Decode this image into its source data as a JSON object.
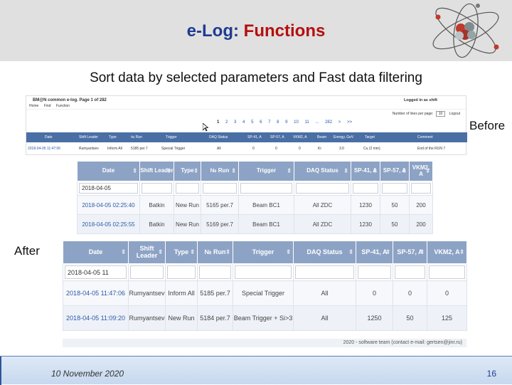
{
  "slide": {
    "title_part1": "e-Log",
    "title_colon": ":",
    "title_part2": " Functions",
    "subtitle": "Sort data by selected parameters and Fast data filtering",
    "label_before": "Before",
    "label_after": "After",
    "date": "10 November 2020",
    "page_number": "16",
    "colors": {
      "title_blue": "#1f3b8f",
      "title_red": "#b50f0f",
      "header_bg": "#e0e0e0",
      "table_header": "#8da3c5"
    }
  },
  "before": {
    "brand": "BM@N common e-log. Page 1 of 282",
    "logged": "Logged in as shift",
    "nav": [
      "Home",
      "Find",
      "Function"
    ],
    "pager": [
      "1",
      "2",
      "3",
      "4",
      "5",
      "6",
      "7",
      "8",
      "9",
      "10",
      "11",
      "...",
      "282",
      ">",
      ">>"
    ],
    "per_page_label": "Number of lines per page:",
    "per_page_value": "10",
    "logout": "Logout",
    "columns": [
      "Date",
      "Shift Leader",
      "Type",
      "№ Run",
      "Trigger",
      "DAQ Status",
      "SP-41, A",
      "SP-57, A",
      "VKM2, A",
      "Beam",
      "Energy, GeV",
      "Target",
      "Comment"
    ],
    "row": [
      "2018-04-05 11:47:06",
      "Rumyantsev",
      "Inform All",
      "5185 per.7",
      "Special Trigger",
      "All",
      "0",
      "0",
      "0",
      "Kr",
      "3.0",
      "Cu (2 mm)",
      "End of the RUN 7"
    ]
  },
  "table_a": {
    "columns": [
      "Date",
      "Shift Leader",
      "Type",
      "№ Run",
      "Trigger",
      "DAQ Status",
      "SP-41, A",
      "SP-57, A",
      "VKM2, A"
    ],
    "filter_date": "2018-04-05",
    "rows": [
      [
        "2018-04-05 02:25:40",
        "Batkin",
        "New Run",
        "5165 per.7",
        "Beam BC1",
        "All ZDC",
        "1230",
        "50",
        "200"
      ],
      [
        "2018-04-05 02:25:55",
        "Batkin",
        "New Run",
        "5169 per.7",
        "Beam BC1",
        "All ZDC",
        "1230",
        "50",
        "200"
      ]
    ]
  },
  "table_b": {
    "columns": [
      "Date",
      "Shift Leader",
      "Type",
      "№ Run",
      "Trigger",
      "DAQ Status",
      "SP-41, A",
      "SP-57, A",
      "VKM2, A"
    ],
    "filter_date": "2018-04-05 11",
    "rows": [
      [
        "2018-04-05 11:47:06",
        "Rumyantsev",
        "Inform All",
        "5185 per.7",
        "Special Trigger",
        "All",
        "0",
        "0",
        "0"
      ],
      [
        "2018-04-05 11:09:20",
        "Rumyantsev",
        "New Run",
        "5184 per.7",
        "Beam Trigger + Si>3",
        "All",
        "1250",
        "50",
        "125"
      ]
    ],
    "footer": "2020 - software team (contact e-mail: gertsen@jinr.ru)"
  }
}
